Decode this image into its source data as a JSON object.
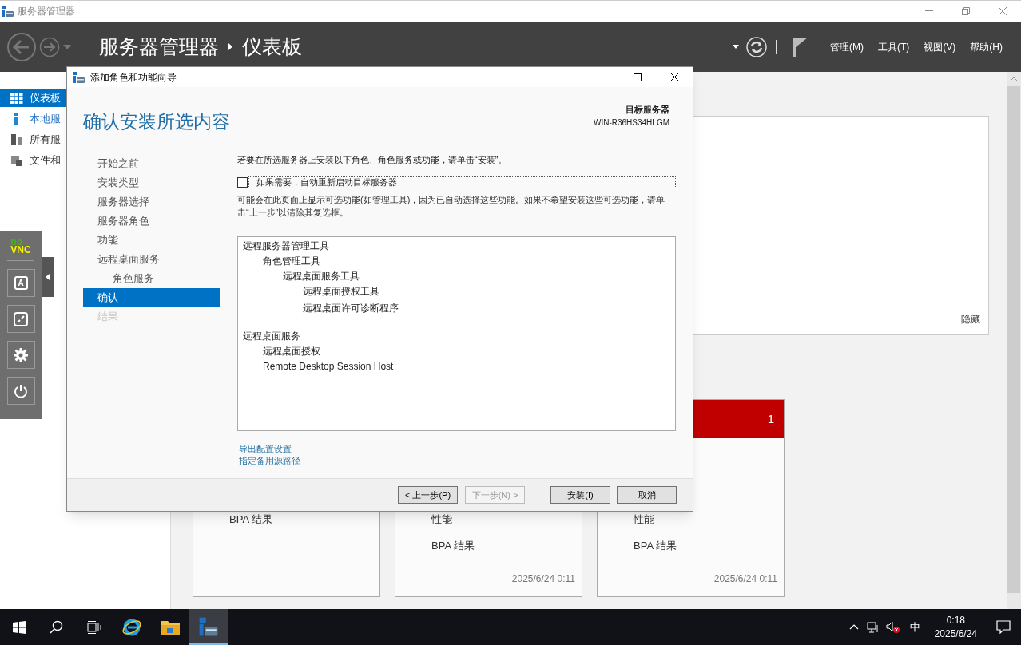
{
  "app": {
    "title": "服务器管理器",
    "breadcrumb_root": "服务器管理器",
    "breadcrumb_current": "仪表板",
    "menus": [
      "管理(M)",
      "工具(T)",
      "视图(V)",
      "帮助(H)"
    ]
  },
  "sidebar": {
    "items": [
      {
        "label": "仪表板",
        "selected": true,
        "kind": "grid"
      },
      {
        "label": "本地服",
        "selected": false,
        "kind": "local"
      },
      {
        "label": "所有服",
        "selected": false,
        "kind": "all"
      },
      {
        "label": "文件和",
        "selected": false,
        "kind": "files"
      }
    ]
  },
  "welcome_panel": {
    "hide_link": "隐藏"
  },
  "cards": [
    {
      "lines": [
        "BPA 结果"
      ]
    },
    {
      "lines": [
        "性能",
        "BPA 结果"
      ],
      "timestamp": "2025/6/24 0:11"
    },
    {
      "header_count": "1",
      "color": "#c00000",
      "lines": [
        "性能",
        "BPA 结果"
      ],
      "timestamp": "2025/6/24 0:11"
    }
  ],
  "vnc_panel": {
    "logo_top": "no",
    "logo_bottom": "VNC",
    "keyboard_key": "A"
  },
  "dialog": {
    "title": "添加角色和功能向导",
    "heading": "确认安装所选内容",
    "target_label": "目标服务器",
    "target_server": "WIN-R36HS34HLGM",
    "steps": [
      {
        "label": "开始之前",
        "selected": false,
        "disabled": false
      },
      {
        "label": "安装类型",
        "selected": false,
        "disabled": false
      },
      {
        "label": "服务器选择",
        "selected": false,
        "disabled": false
      },
      {
        "label": "服务器角色",
        "selected": false,
        "disabled": false
      },
      {
        "label": "功能",
        "selected": false,
        "disabled": false
      },
      {
        "label": "远程桌面服务",
        "selected": false,
        "disabled": false,
        "children": [
          {
            "label": "角色服务",
            "selected": false,
            "disabled": false
          }
        ]
      },
      {
        "label": "确认",
        "selected": true,
        "disabled": false
      },
      {
        "label": "结果",
        "selected": false,
        "disabled": true
      }
    ],
    "intro": "若要在所选服务器上安装以下角色、角色服务或功能，请单击“安装”。",
    "restart": {
      "label": "如果需要，自动重新启动目标服务器",
      "checked": false
    },
    "note": "可能会在此页面上显示可选功能(如管理工具)，因为已自动选择这些功能。如果不希望安装这些可选功能，请单击“上一步”以清除其复选框。",
    "features": [
      {
        "label": "远程服务器管理工具",
        "children": [
          {
            "label": "角色管理工具",
            "children": [
              {
                "label": "远程桌面服务工具",
                "children": [
                  {
                    "label": "远程桌面授权工具"
                  },
                  {
                    "label": "远程桌面许可诊断程序"
                  }
                ]
              }
            ]
          }
        ]
      },
      {
        "label": "远程桌面服务",
        "children": [
          {
            "label": "远程桌面授权"
          },
          {
            "label": "Remote Desktop Session Host"
          }
        ]
      }
    ],
    "links": [
      "导出配置设置",
      "指定备用源路径"
    ],
    "buttons": [
      {
        "label": "< 上一步(P)",
        "disabled": false
      },
      {
        "label": "下一步(N) >",
        "disabled": true
      },
      {
        "label": "安装(I)",
        "disabled": false
      },
      {
        "label": "取消",
        "disabled": false
      }
    ]
  },
  "taskbar": {
    "ime": "中",
    "time": "0:18",
    "date": "2025/6/24"
  }
}
